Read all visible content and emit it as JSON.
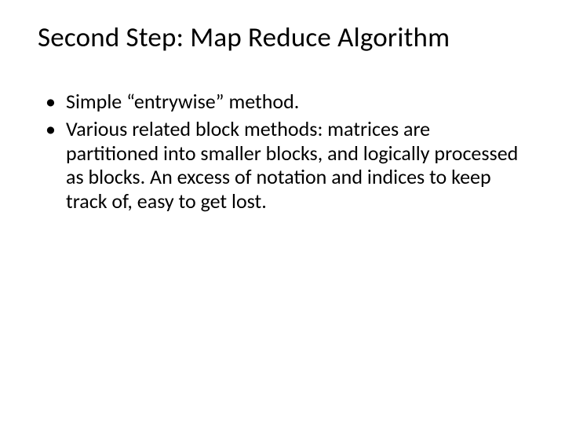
{
  "title": "Second Step: Map Reduce Algorithm",
  "bullets": [
    "Simple “entrywise” method.",
    "Various related block methods: matrices are partitioned into smaller blocks, and logically processed as blocks. An excess of notation and indices to keep track of, easy to get lost."
  ]
}
